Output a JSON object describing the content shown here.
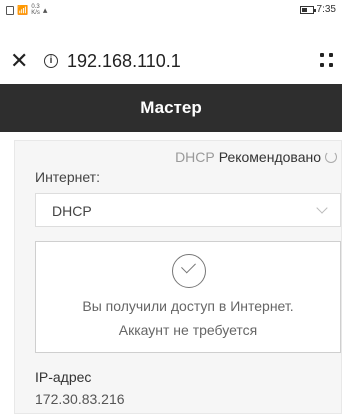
{
  "status_bar": {
    "speed_value": "0.3",
    "speed_unit": "K/s",
    "time": "7:35",
    "icons": [
      "notification-icon",
      "wifi-icon",
      "signal-icon",
      "battery-icon"
    ]
  },
  "address_bar": {
    "url": "192.168.110.1",
    "icons": [
      "close-icon",
      "info-icon",
      "menu-dots-icon"
    ]
  },
  "header": {
    "title": "Мастер"
  },
  "wizard": {
    "mode": "DHCP",
    "mode_note": "Рекомендовано",
    "internet_label": "Интернет:",
    "internet_select_value": "DHCP",
    "success_line1": "Вы получили доступ в Интернет.",
    "success_line2": "Аккаунт не требуется",
    "ip_label": "IP-адрес",
    "ip_value": "172.30.83.216"
  },
  "colors": {
    "header_bg": "#2e2e2e",
    "content_bg": "#f6f6f6"
  }
}
